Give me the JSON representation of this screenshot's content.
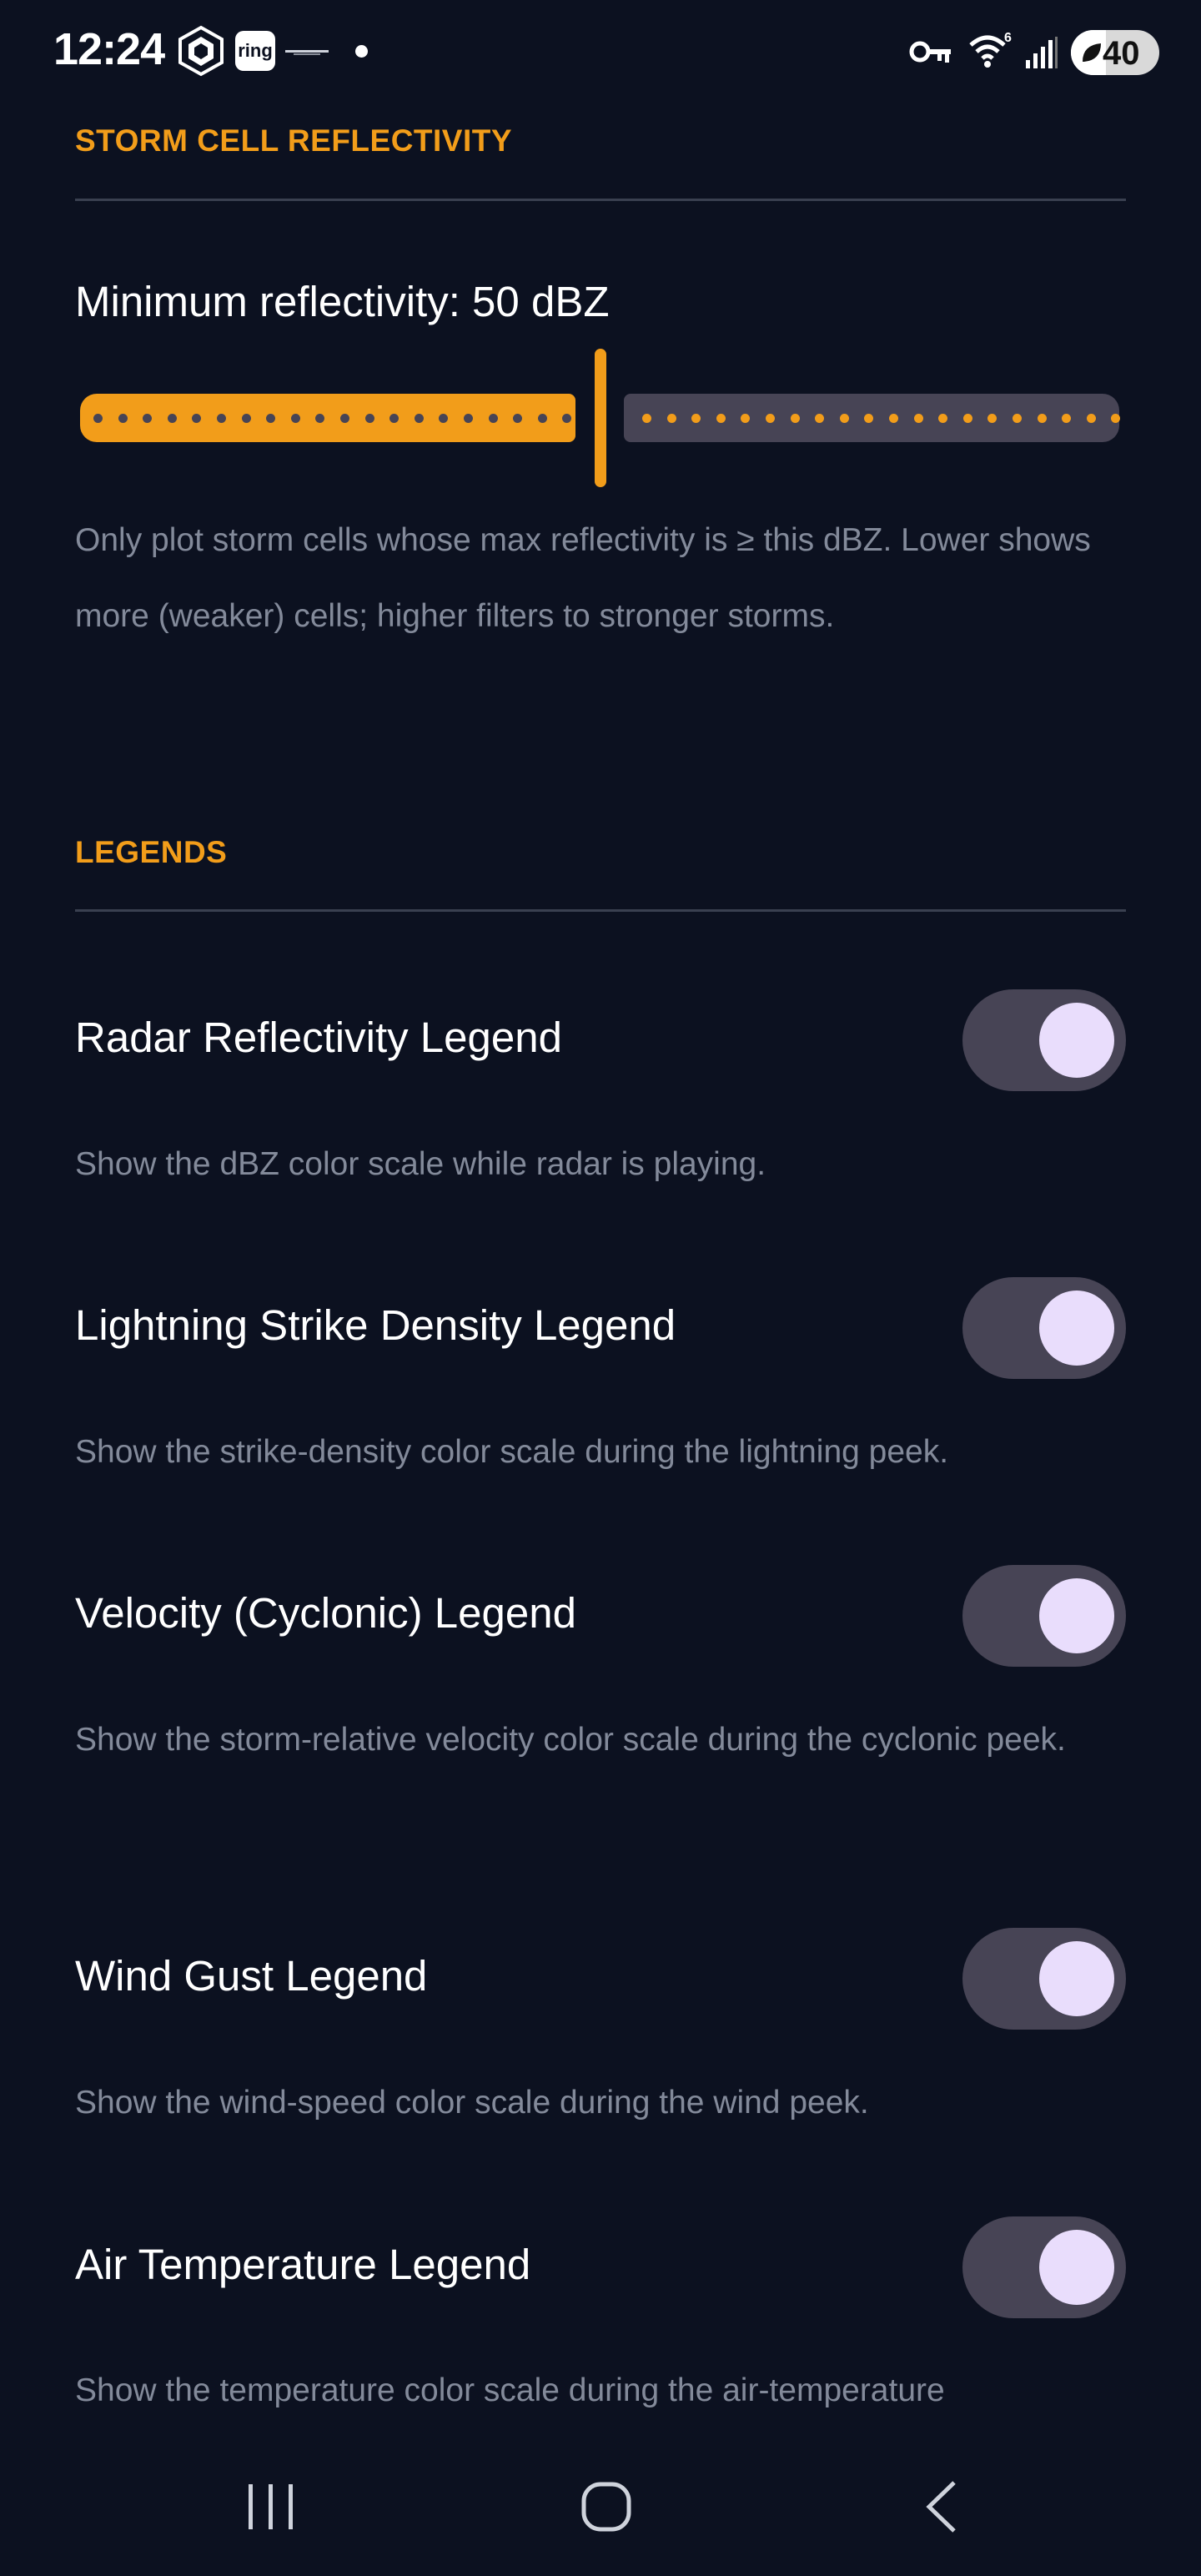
{
  "status_bar": {
    "time": "12:24",
    "ring_label": "ring",
    "battery_level": "40",
    "icons": [
      "crypto-com-icon",
      "ring-icon",
      "brand-icon",
      "notification-dot-icon",
      "vpn-key-icon",
      "wifi-6-icon",
      "signal-icon",
      "battery-saver-icon"
    ]
  },
  "storm_section": {
    "header": "STORM CELL REFLECTIVITY",
    "slider_label": "Minimum reflectivity: 50 dBZ",
    "slider_value_fraction": 0.5,
    "description": "Only plot storm cells whose max reflectivity is ≥ this dBZ. Lower shows more (weaker) cells; higher filters to stronger storms."
  },
  "legends_section": {
    "header": "LEGENDS",
    "items": [
      {
        "title": "Radar Reflectivity Legend",
        "description": "Show the dBZ color scale while radar is playing.",
        "enabled": true
      },
      {
        "title": "Lightning Strike Density Legend",
        "description": "Show the strike-density color scale during the lightning peek.",
        "enabled": true
      },
      {
        "title": "Velocity (Cyclonic) Legend",
        "description": "Show the storm-relative velocity color scale during the cyclonic peek.",
        "enabled": true
      },
      {
        "title": "Wind Gust Legend",
        "description": "Show the wind-speed color scale during the wind peek.",
        "enabled": true
      },
      {
        "title": "Air Temperature Legend",
        "description": "Show the temperature color scale during the air-temperature",
        "enabled": true
      }
    ]
  },
  "nav_bar": {
    "icons": [
      "recent-apps-icon",
      "home-icon",
      "back-icon"
    ]
  },
  "colors": {
    "background": "#0c1120",
    "accent": "#f29d1a",
    "toggle_track": "#474455",
    "toggle_knob": "#e9ddfc",
    "description_text": "#838a9a"
  }
}
